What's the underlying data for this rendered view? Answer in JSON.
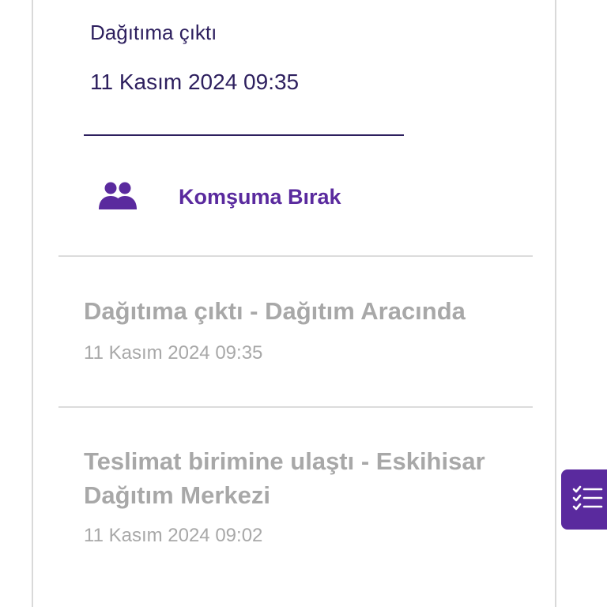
{
  "active_event": {
    "status": "Dağıtıma çıktı",
    "date": "11 Kasım 2024 09:35"
  },
  "neighbor_action": {
    "label": "Komşuma Bırak",
    "icon": "users-icon"
  },
  "events": [
    {
      "title": "Dağıtıma çıktı - Dağıtım Aracında",
      "date": "11 Kasım 2024 09:35"
    },
    {
      "title": "Teslimat birimine ulaştı - Eskihisar Dağıtım Merkezi",
      "date": "11 Kasım 2024 09:02"
    }
  ],
  "side_button": {
    "icon": "checklist-icon"
  },
  "colors": {
    "brand_purple": "#5a2a9e",
    "active_text": "#2d1f5e",
    "inactive_text": "#a8a8a8",
    "divider": "#dcdcdc"
  }
}
